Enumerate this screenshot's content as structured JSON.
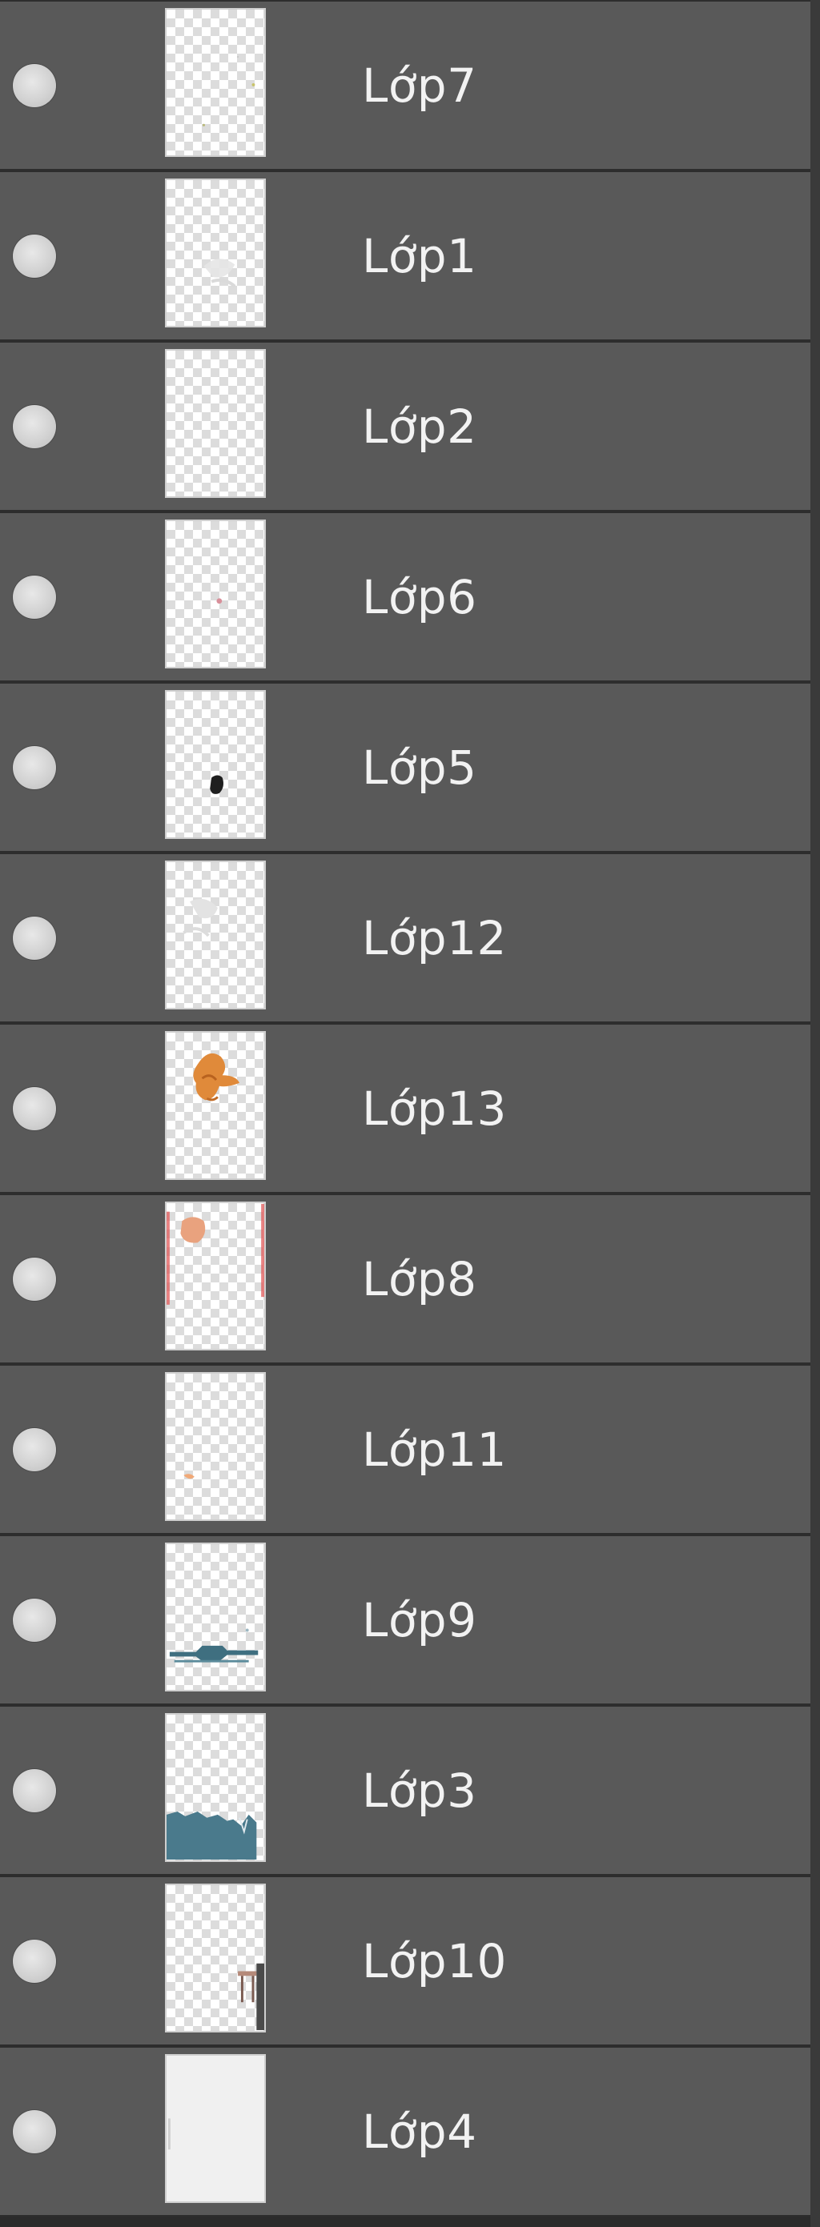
{
  "panel": {
    "layers": [
      {
        "name": "Lớp7",
        "thumbnail": "sparse-dots-thumbnail"
      },
      {
        "name": "Lớp1",
        "thumbnail": "faint-sketch-thumbnail"
      },
      {
        "name": "Lớp2",
        "thumbnail": "empty-thumbnail"
      },
      {
        "name": "Lớp6",
        "thumbnail": "small-pink-dot-thumbnail"
      },
      {
        "name": "Lớp5",
        "thumbnail": "dark-blob-thumbnail"
      },
      {
        "name": "Lớp12",
        "thumbnail": "faint-sketch-thumbnail"
      },
      {
        "name": "Lớp13",
        "thumbnail": "orange-figure-thumbnail"
      },
      {
        "name": "Lớp8",
        "thumbnail": "peach-shape-with-red-edges-thumbnail"
      },
      {
        "name": "Lớp11",
        "thumbnail": "small-orange-mark-thumbnail"
      },
      {
        "name": "Lớp9",
        "thumbnail": "teal-strokes-thumbnail"
      },
      {
        "name": "Lớp3",
        "thumbnail": "teal-bottom-fill-thumbnail"
      },
      {
        "name": "Lớp10",
        "thumbnail": "small-brown-object-thumbnail"
      },
      {
        "name": "Lớp4",
        "thumbnail": "white-fill-thumbnail"
      }
    ]
  },
  "colors": {
    "row_background": "#595959",
    "row_divider": "#2d2d2d",
    "label": "#f2f2f2",
    "teal_paint": "#4a7a8c",
    "orange_paint": "#e08a3a",
    "peach_paint": "#e9a27e",
    "red_edge": "#e25a5a"
  }
}
